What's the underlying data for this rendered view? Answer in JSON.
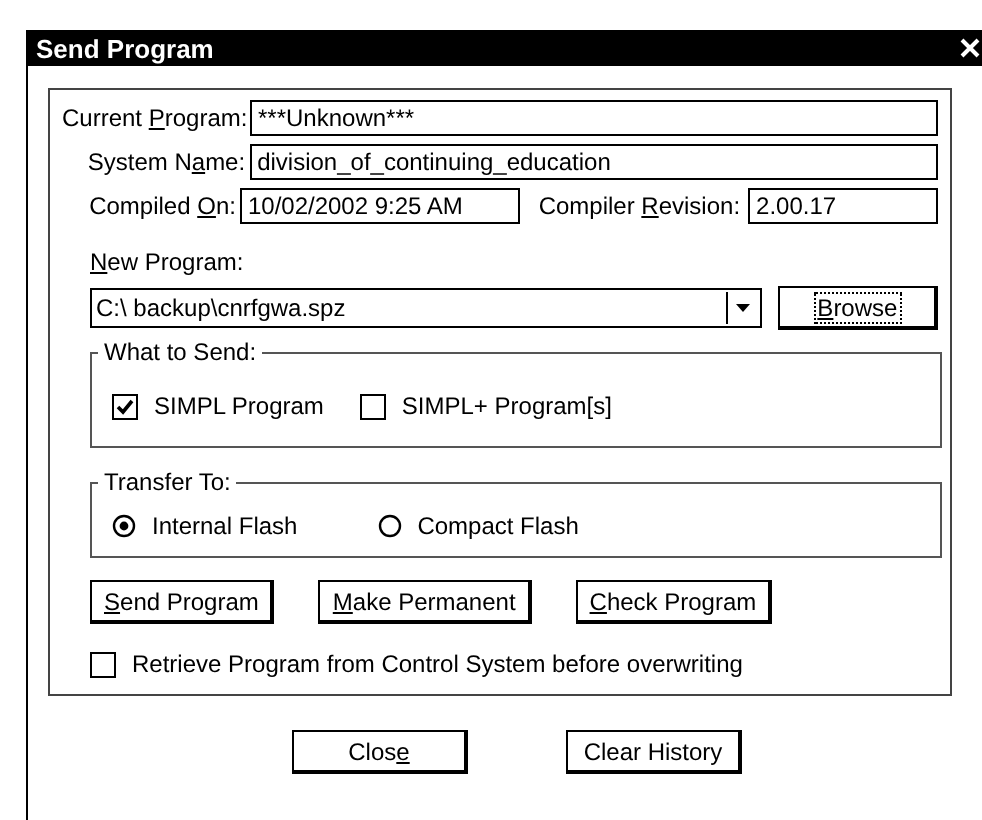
{
  "window": {
    "title": "Send Program"
  },
  "fields": [
    {
      "label": {
        "pre": "Current ",
        "key": "P",
        "post": "rogram:"
      },
      "value": "***Unknown***"
    },
    {
      "label": {
        "pre": "System N",
        "key": "a",
        "post": "me:"
      },
      "value": "division_of_continuing_education"
    }
  ],
  "compiled_on": {
    "label": {
      "pre": "Compiled ",
      "key": "O",
      "post": "n:"
    },
    "value": "10/02/2002 9:25 AM"
  },
  "compiler_revision": {
    "label": {
      "pre": "Compiler ",
      "key": "R",
      "post": "evision:"
    },
    "value": "2.00.17"
  },
  "new_program": {
    "label": {
      "key": "N",
      "post": "ew Program:"
    },
    "value": "C:\\ backup\\cnrfgwa.spz"
  },
  "browse_button": {
    "label": {
      "key": "B",
      "post": "rowse"
    },
    "focused": true
  },
  "what_to_send": {
    "title": "What to Send:",
    "options": [
      {
        "label": "SIMPL Program",
        "checked": true
      },
      {
        "label": "SIMPL+ Program[s]",
        "checked": false
      }
    ]
  },
  "transfer_to": {
    "title": "Transfer To:",
    "options": [
      {
        "label": "Internal Flash",
        "selected": true
      },
      {
        "label": "Compact Flash",
        "selected": false
      }
    ]
  },
  "actions": [
    {
      "label": {
        "key": "S",
        "post": "end Program"
      }
    },
    {
      "label": {
        "key": "M",
        "post": "ake Permanent"
      }
    },
    {
      "label": {
        "key": "C",
        "post": "heck Program"
      }
    }
  ],
  "retrieve": {
    "label": "Retrieve Program from Control System before overwriting",
    "checked": false
  },
  "footer_buttons": [
    {
      "label": {
        "pre": "Clos",
        "key": "e"
      }
    },
    {
      "label": {
        "pre": "Clear History"
      }
    }
  ]
}
